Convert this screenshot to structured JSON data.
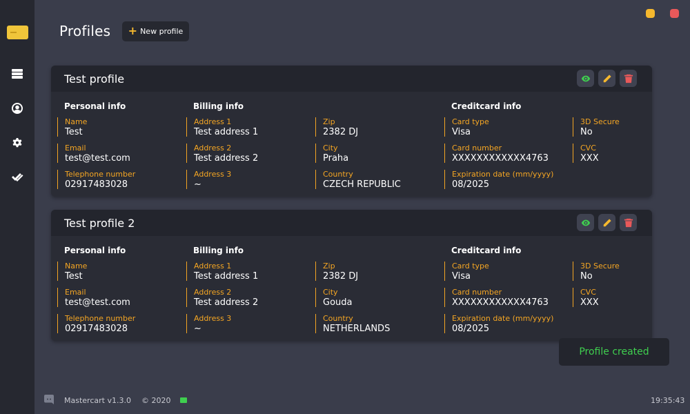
{
  "window": {
    "minimize_color": "#f5b82e",
    "close_color": "#e8595a"
  },
  "sidebar": {
    "logo_icon": "credit-card-logo",
    "items": [
      {
        "icon": "servers-icon"
      },
      {
        "icon": "user-circle-icon"
      },
      {
        "icon": "gear-icon"
      },
      {
        "icon": "double-check-icon"
      }
    ]
  },
  "header": {
    "title": "Profiles",
    "new_profile_label": "New profile",
    "new_profile_icon": "+"
  },
  "sections": {
    "personal": "Personal info",
    "billing": "Billing info",
    "card": "Creditcard info"
  },
  "labels": {
    "name": "Name",
    "email": "Email",
    "telephone": "Telephone number",
    "address1": "Address 1",
    "address2": "Address 2",
    "address3": "Address 3",
    "zip": "Zip",
    "city": "City",
    "country": "Country",
    "card_type": "Card type",
    "card_number": "Card number",
    "expiration": "Expiration date (mm/yyyy)",
    "secure": "3D Secure",
    "cvc": "CVC"
  },
  "profiles": [
    {
      "title": "Test profile",
      "name": "Test",
      "email": "test@test.com",
      "telephone": "02917483028",
      "address1": "Test address 1",
      "address2": "Test address 2",
      "address3": "~",
      "zip": "2382 DJ",
      "city": "Praha",
      "country": "CZECH REPUBLIC",
      "card_type": "Visa",
      "card_number": "XXXXXXXXXXXX4763",
      "expiration": "08/2025",
      "secure": "No",
      "cvc": "XXX"
    },
    {
      "title": "Test profile 2",
      "name": "Test",
      "email": "test@test.com",
      "telephone": "02917483028",
      "address1": "Test address 1",
      "address2": "Test address 2",
      "address3": "~",
      "zip": "2382 DJ",
      "city": "Gouda",
      "country": "NETHERLANDS",
      "card_type": "Visa",
      "card_number": "XXXXXXXXXXXX4763",
      "expiration": "08/2025",
      "secure": "No",
      "cvc": "XXX"
    }
  ],
  "toast": {
    "message": "Profile created",
    "color": "#3fcf4f"
  },
  "footer": {
    "version": "Mastercart v1.3.0",
    "copyright": "© 2020",
    "status_color": "#3fcf4f",
    "time": "19:35:43"
  },
  "colors": {
    "accent": "#f5a623",
    "background": "#3a3d4b",
    "sidebar": "#262830",
    "card": "#2a2c35",
    "view_icon": "#3fcf4f",
    "edit_icon": "#f5b82e",
    "delete_icon": "#e8595a"
  }
}
